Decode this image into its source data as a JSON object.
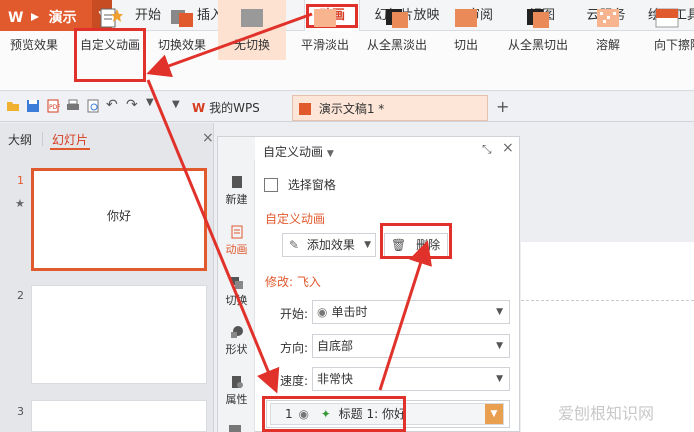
{
  "app": {
    "logo_text": "WPS 演示"
  },
  "menu": [
    "开始",
    "插入",
    "设计",
    "动画",
    "幻灯片放映",
    "审阅",
    "视图",
    "云服务",
    "绘图工具"
  ],
  "ribbon": [
    "预览效果",
    "自定义动画",
    "切换效果",
    "无切换",
    "平滑淡出",
    "从全黑淡出",
    "切出",
    "从全黑切出",
    "溶解",
    "向下擦除"
  ],
  "tabs": {
    "home": "我的WPS",
    "doc": "演示文稿1 *"
  },
  "left_panel": {
    "tab_outline": "大纲",
    "tab_slides": "幻灯片",
    "slide1_text": "你好",
    "slide_numbers": [
      "1",
      "2",
      "3"
    ]
  },
  "task_panel": {
    "title": "自定义动画",
    "select_pane": "选择窗格",
    "section_title": "自定义动画",
    "add_effect": "添加效果",
    "delete": "删除",
    "modify": "修改: 飞入",
    "start_label": "开始:",
    "start_value": "单击时",
    "direction_label": "方向:",
    "direction_value": "自底部",
    "speed_label": "速度:",
    "speed_value": "非常快",
    "list_item": {
      "index": "1",
      "text": "标题 1: 你好"
    }
  },
  "sidebar": [
    "新建",
    "动画",
    "切换",
    "形状",
    "属性"
  ],
  "watermark": "爱刨根知识网",
  "colors": {
    "accent": "#e15a2e",
    "highlight": "#e0322a"
  }
}
